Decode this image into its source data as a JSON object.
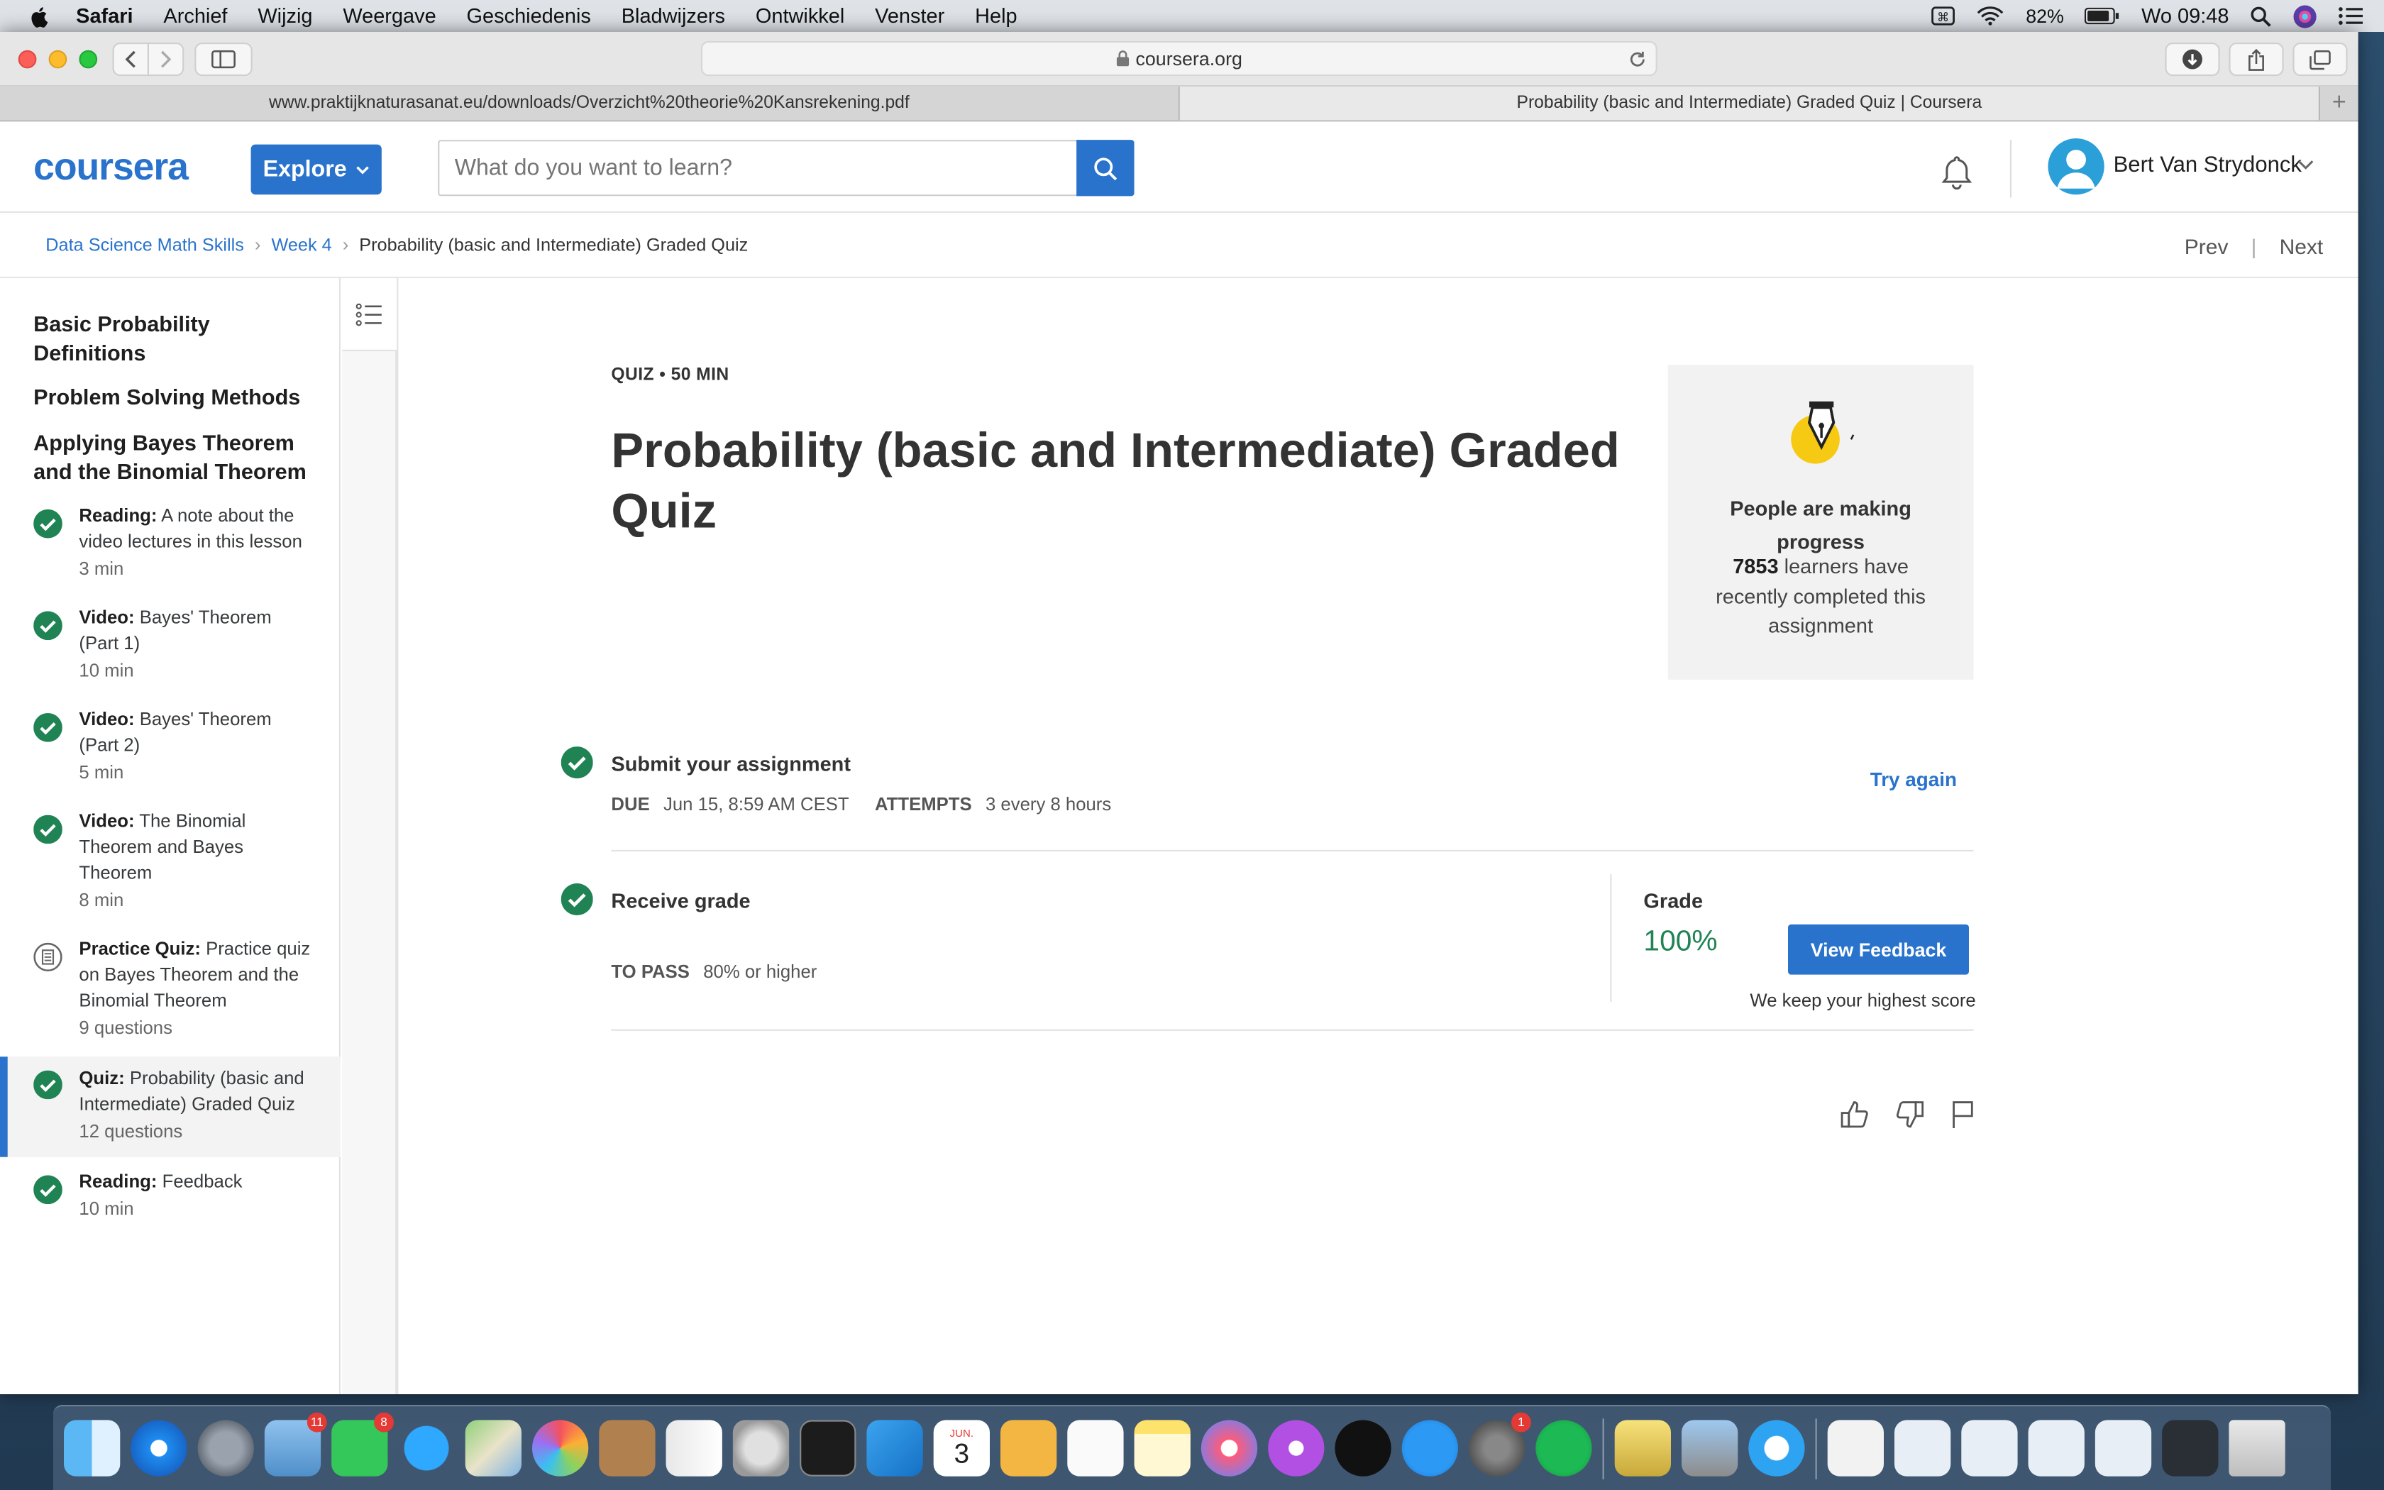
{
  "menubar": {
    "app": "Safari",
    "items": [
      "Archief",
      "Wijzig",
      "Weergave",
      "Geschiedenis",
      "Bladwijzers",
      "Ontwikkel",
      "Venster",
      "Help"
    ],
    "battery": "82%",
    "clock": "Wo 09:48"
  },
  "browser": {
    "url": "coursera.org",
    "tabs": [
      {
        "label": "www.praktijknaturasanat.eu/downloads/Overzicht%20theorie%20Kansrekening.pdf",
        "active": false
      },
      {
        "label": "Probability (basic and Intermediate) Graded Quiz | Coursera",
        "active": true
      }
    ],
    "new_tab": "+"
  },
  "header": {
    "logo": "coursera",
    "explore_label": "Explore",
    "search_placeholder": "What do you want to learn?",
    "user_name": "Bert Van Strydonck"
  },
  "breadcrumb": {
    "items": [
      "Data Science Math Skills",
      "Week 4"
    ],
    "current": "Probability (basic and Intermediate) Graded Quiz",
    "prev": "Prev",
    "next": "Next"
  },
  "sidebar": {
    "sections": [
      "Basic Probability Definitions",
      "Problem Solving Methods",
      "Applying Bayes Theorem and the Binomial Theorem"
    ],
    "items": [
      {
        "type": "Reading:",
        "title": "A note about the video lectures in this lesson",
        "meta": "3 min",
        "status": "completed"
      },
      {
        "type": "Video:",
        "title": "Bayes' Theorem (Part 1)",
        "meta": "10 min",
        "status": "completed"
      },
      {
        "type": "Video:",
        "title": "Bayes' Theorem (Part 2)",
        "meta": "5 min",
        "status": "completed"
      },
      {
        "type": "Video:",
        "title": "The Binomial Theorem and Bayes Theorem",
        "meta": "8 min",
        "status": "completed"
      },
      {
        "type": "Practice Quiz:",
        "title": "Practice quiz on Bayes Theorem and the Binomial Theorem",
        "meta": "9 questions",
        "status": "practice"
      },
      {
        "type": "Quiz:",
        "title": "Probability (basic and Intermediate) Graded Quiz",
        "meta": "12 questions",
        "status": "completed",
        "active": true
      },
      {
        "type": "Reading:",
        "title": "Feedback",
        "meta": "10 min",
        "status": "completed"
      }
    ]
  },
  "quiz": {
    "meta": "QUIZ • 50 MIN",
    "title": "Probability (basic and Intermediate) Graded Quiz",
    "progress_title": "People are making progress",
    "progress_count": "7853",
    "progress_text": "learners have recently completed this assignment",
    "submit_title": "Submit your assignment",
    "due_label": "DUE",
    "due_value": "Jun 15, 8:59 AM CEST",
    "attempts_label": "ATTEMPTS",
    "attempts_value": "3 every 8 hours",
    "try_again": "Try again",
    "receive_title": "Receive grade",
    "to_pass_label": "TO PASS",
    "to_pass_value": "80% or higher",
    "grade_label": "Grade",
    "grade_value": "100%",
    "view_feedback": "View Feedback",
    "keep_note": "We keep your highest score"
  },
  "dock": {
    "badges": {
      "mail": "11",
      "facetime": "8",
      "system_prefs": "1"
    },
    "calendar_month": "JUN.",
    "calendar_day": "3"
  },
  "colors": {
    "brand": "#2a73cc",
    "success": "#1f8354",
    "check_green": "#1f8354"
  }
}
